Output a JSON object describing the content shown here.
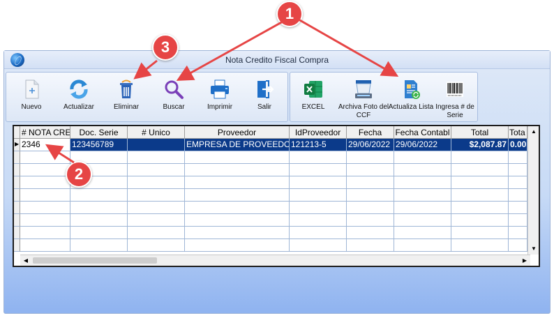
{
  "window": {
    "title": "Nota Credito Fiscal Compra"
  },
  "toolbar": {
    "group1": [
      {
        "label": "Nuevo",
        "icon": "new-document-icon"
      },
      {
        "label": "Actualizar",
        "icon": "refresh-icon"
      },
      {
        "label": "Eliminar",
        "icon": "trash-icon"
      },
      {
        "label": "Buscar",
        "icon": "search-icon"
      },
      {
        "label": "Imprimir",
        "icon": "printer-icon"
      },
      {
        "label": "Salir",
        "icon": "exit-icon"
      }
    ],
    "group2": [
      {
        "label": "EXCEL",
        "icon": "excel-icon"
      },
      {
        "label": "Archiva Foto del CCF",
        "icon": "scanner-icon"
      },
      {
        "label": "Actualiza Lista",
        "icon": "update-list-icon"
      },
      {
        "label": "Ingresa # de Serie",
        "icon": "barcode-icon"
      }
    ]
  },
  "grid": {
    "columns": [
      "# NOTA CRE",
      "Doc. Serie",
      "# Unico",
      "Proveedor",
      "IdProveedor",
      "Fecha",
      "Fecha Contabl",
      "Total",
      "Tota"
    ],
    "rows": [
      [
        "2346",
        "123456789",
        "",
        "EMPRESA DE PROVEEDO",
        "121213-5",
        "29/06/2022",
        "29/06/2022",
        "$2,087.87",
        "0.00"
      ]
    ]
  },
  "callouts": [
    "1",
    "2",
    "3"
  ],
  "colors": {
    "selection": "#0b3a8a",
    "callout": "#e64545",
    "window_bottom": "#8fb3f0"
  }
}
